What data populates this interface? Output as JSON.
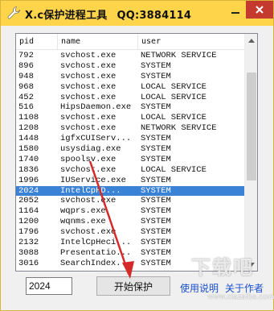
{
  "window": {
    "title": "X.c保护进程工具",
    "qq": "QQ:3884114",
    "titlebar_color": "#fed44a",
    "close_color": "#c53a2f"
  },
  "list": {
    "columns": {
      "pid": "pid",
      "name": "name",
      "user": "user"
    },
    "rows": [
      {
        "pid": "792",
        "name": "svchost.exe",
        "user": "NETWORK SERVICE"
      },
      {
        "pid": "896",
        "name": "svchost.exe",
        "user": "SYSTEM"
      },
      {
        "pid": "948",
        "name": "svchost.exe",
        "user": "SYSTEM"
      },
      {
        "pid": "968",
        "name": "svchost.exe",
        "user": "LOCAL SERVICE"
      },
      {
        "pid": "452",
        "name": "svchost.exe",
        "user": "LOCAL SERVICE"
      },
      {
        "pid": "516",
        "name": "HipsDaemon.exe",
        "user": "SYSTEM"
      },
      {
        "pid": "1108",
        "name": "svchost.exe",
        "user": "LOCAL SERVICE"
      },
      {
        "pid": "1208",
        "name": "svchost.exe",
        "user": "NETWORK SERVICE"
      },
      {
        "pid": "1448",
        "name": "igfxCUIServ...",
        "user": "SYSTEM"
      },
      {
        "pid": "1580",
        "name": "usysdiag.exe",
        "user": "SYSTEM"
      },
      {
        "pid": "1740",
        "name": "spoolsv.exe",
        "user": "SYSTEM"
      },
      {
        "pid": "1836",
        "name": "svchost.exe",
        "user": "LOCAL SERVICE"
      },
      {
        "pid": "1996",
        "name": "IUService.exe",
        "user": "SYSTEM"
      },
      {
        "pid": "2024",
        "name": "IntelCpHD...",
        "user": "SYSTEM"
      },
      {
        "pid": "2052",
        "name": "svchost.exe",
        "user": "SYSTEM"
      },
      {
        "pid": "1164",
        "name": "wqprs.exe",
        "user": "SYSTEM"
      },
      {
        "pid": "1200",
        "name": "wqnms.exe",
        "user": "SYSTEM"
      },
      {
        "pid": "1796",
        "name": "svchost.exe",
        "user": "SYSTEM"
      },
      {
        "pid": "2132",
        "name": "IntelCpHeci...",
        "user": "SYSTEM"
      },
      {
        "pid": "3088",
        "name": "Presentatio...",
        "user": "SYSTEM"
      },
      {
        "pid": "3016",
        "name": "SearchIndex...",
        "user": "SYSTEM"
      }
    ],
    "selected_pid": "2024",
    "selection_color": "#3a82d6"
  },
  "controls": {
    "pid_value": "2024",
    "protect_button": "开始保护",
    "help_link": "使用说明",
    "about_link": "关于作者"
  },
  "annotation": {
    "arrow_color": "#d42a2a"
  },
  "watermark": {
    "text": "下载吧",
    "sub": "www.xiazaiba.com"
  }
}
